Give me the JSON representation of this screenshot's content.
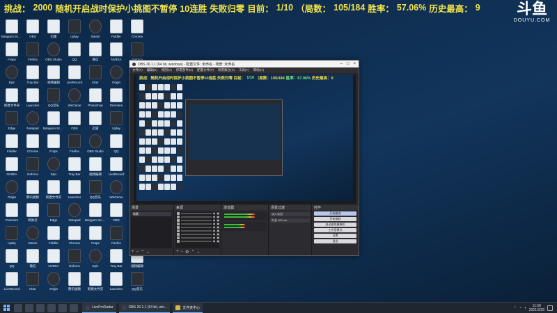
{
  "banner": {
    "challenge_label": "挑战：",
    "challenge_value": "2000",
    "challenge_text_hidden": "随机开启战时保护小挑图不暂停",
    "streak": "10连胜",
    "fail_rule": "失败归零",
    "current_label": "目前：",
    "current_value": "1/10",
    "rounds_label": "（局数：",
    "rounds_value": "105/184",
    "winrate_label": "胜率：",
    "winrate_value": "57.06%",
    "best_label": "历史最高：",
    "best_value": "9"
  },
  "watermark": {
    "logo": "斗鱼",
    "site": "DOUYU.COM"
  },
  "desktop_icons": [
    "Bangumi Scanner",
    "OBS",
    "迅雷",
    "Uplay",
    "Steam",
    "Fiddler",
    "Chrome",
    "Fraps",
    "Firefox",
    "OBS Studio",
    "QQ",
    "微信",
    "NVIDIA",
    "Geforce",
    "Epic",
    "Tray Bar",
    "视频编辑",
    "LiveRecord",
    "Kbar",
    "Origin",
    "腾讯视频",
    "新建文件夹",
    "Launcher",
    "QQ音乐",
    "WeGame",
    "Photoshop",
    "Premiere",
    "网易云",
    "Edge",
    "Notepad"
  ],
  "obs": {
    "title": "OBS 26.1.1 (64 bit, windows) - 配置文件: 未命名 - 场景: 未命名",
    "menu": [
      "文件(F)",
      "编辑(E)",
      "视图(V)",
      "停靠部件(D)",
      "配置文件(P)",
      "场景集合(S)",
      "工具(T)",
      "帮助(H)"
    ],
    "preview_banner": {
      "prefix": "挑战：随机开启战时保护小挑图不暂停10连胜 失败归零 目前：",
      "current": "1/10",
      "rounds": "（局数：105/184",
      "winrate": "胜率：57.06%",
      "best": "历史最高：9"
    },
    "docks": {
      "scenes_title": "场景",
      "scenes": [
        "场景"
      ],
      "sources_title": "来源",
      "mixer_title": "混音器",
      "mixer_tracks": [
        "桌面音频",
        "麦克风/Aux"
      ],
      "transitions_title": "场景过渡",
      "transitions": [
        "淡入淡出",
        "时长 300 ms"
      ],
      "controls_title": "控件",
      "controls": [
        "开始推流",
        "开始录制",
        "启动虚拟摄像机",
        "工作室模式",
        "设置",
        "退出"
      ]
    }
  },
  "taskbar": {
    "apps": [
      {
        "label": "LiveProRadar"
      },
      {
        "label": "OBS 26.1.1 (64 bit, win..."
      },
      {
        "label": "文件夹中心"
      }
    ],
    "time": "11:58",
    "date": "2021/3/28"
  }
}
